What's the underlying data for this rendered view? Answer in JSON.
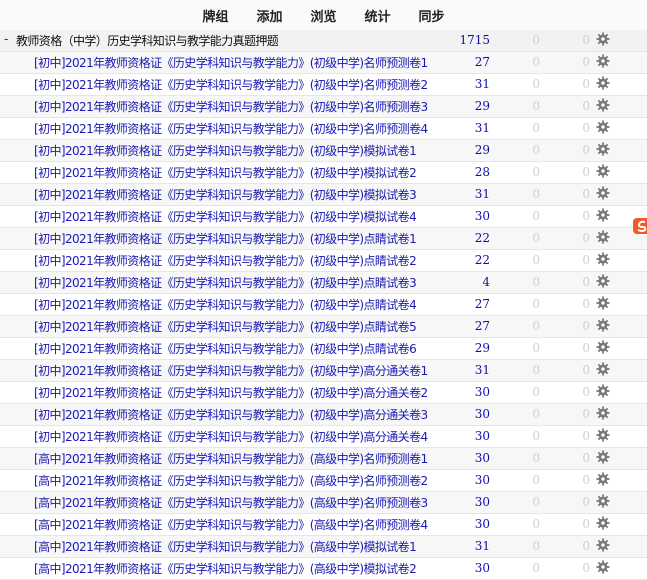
{
  "toolbar": {
    "items": [
      "牌组",
      "添加",
      "浏览",
      "统计",
      "同步"
    ]
  },
  "parent": {
    "toggle": "-",
    "name": "教师资格（中学）历史学科知识与教学能力真题押题",
    "new": "1715",
    "learn": "0",
    "due": "0"
  },
  "decks": [
    {
      "name": "[初中]2021年教师资格证《历史学科知识与教学能力》(初级中学)名师预测卷1",
      "new": "27",
      "learn": "0",
      "due": "0"
    },
    {
      "name": "[初中]2021年教师资格证《历史学科知识与教学能力》(初级中学)名师预测卷2",
      "new": "31",
      "learn": "0",
      "due": "0"
    },
    {
      "name": "[初中]2021年教师资格证《历史学科知识与教学能力》(初级中学)名师预测卷3",
      "new": "29",
      "learn": "0",
      "due": "0"
    },
    {
      "name": "[初中]2021年教师资格证《历史学科知识与教学能力》(初级中学)名师预测卷4",
      "new": "31",
      "learn": "0",
      "due": "0"
    },
    {
      "name": "[初中]2021年教师资格证《历史学科知识与教学能力》(初级中学)模拟试卷1",
      "new": "29",
      "learn": "0",
      "due": "0"
    },
    {
      "name": "[初中]2021年教师资格证《历史学科知识与教学能力》(初级中学)模拟试卷2",
      "new": "28",
      "learn": "0",
      "due": "0"
    },
    {
      "name": "[初中]2021年教师资格证《历史学科知识与教学能力》(初级中学)模拟试卷3",
      "new": "31",
      "learn": "0",
      "due": "0"
    },
    {
      "name": "[初中]2021年教师资格证《历史学科知识与教学能力》(初级中学)模拟试卷4",
      "new": "30",
      "learn": "0",
      "due": "0"
    },
    {
      "name": "[初中]2021年教师资格证《历史学科知识与教学能力》(初级中学)点睛试卷1",
      "new": "22",
      "learn": "0",
      "due": "0"
    },
    {
      "name": "[初中]2021年教师资格证《历史学科知识与教学能力》(初级中学)点睛试卷2",
      "new": "22",
      "learn": "0",
      "due": "0"
    },
    {
      "name": "[初中]2021年教师资格证《历史学科知识与教学能力》(初级中学)点睛试卷3",
      "new": "4",
      "learn": "0",
      "due": "0"
    },
    {
      "name": "[初中]2021年教师资格证《历史学科知识与教学能力》(初级中学)点睛试卷4",
      "new": "27",
      "learn": "0",
      "due": "0"
    },
    {
      "name": "[初中]2021年教师资格证《历史学科知识与教学能力》(初级中学)点睛试卷5",
      "new": "27",
      "learn": "0",
      "due": "0"
    },
    {
      "name": "[初中]2021年教师资格证《历史学科知识与教学能力》(初级中学)点睛试卷6",
      "new": "29",
      "learn": "0",
      "due": "0"
    },
    {
      "name": "[初中]2021年教师资格证《历史学科知识与教学能力》(初级中学)高分通关卷1",
      "new": "31",
      "learn": "0",
      "due": "0"
    },
    {
      "name": "[初中]2021年教师资格证《历史学科知识与教学能力》(初级中学)高分通关卷2",
      "new": "30",
      "learn": "0",
      "due": "0"
    },
    {
      "name": "[初中]2021年教师资格证《历史学科知识与教学能力》(初级中学)高分通关卷3",
      "new": "30",
      "learn": "0",
      "due": "0"
    },
    {
      "name": "[初中]2021年教师资格证《历史学科知识与教学能力》(初级中学)高分通关卷4",
      "new": "30",
      "learn": "0",
      "due": "0"
    },
    {
      "name": "[高中]2021年教师资格证《历史学科知识与教学能力》(高级中学)名师预测卷1",
      "new": "30",
      "learn": "0",
      "due": "0"
    },
    {
      "name": "[高中]2021年教师资格证《历史学科知识与教学能力》(高级中学)名师预测卷2",
      "new": "30",
      "learn": "0",
      "due": "0"
    },
    {
      "name": "[高中]2021年教师资格证《历史学科知识与教学能力》(高级中学)名师预测卷3",
      "new": "30",
      "learn": "0",
      "due": "0"
    },
    {
      "name": "[高中]2021年教师资格证《历史学科知识与教学能力》(高级中学)名师预测卷4",
      "new": "30",
      "learn": "0",
      "due": "0"
    },
    {
      "name": "[高中]2021年教师资格证《历史学科知识与教学能力》(高级中学)模拟试卷1",
      "new": "31",
      "learn": "0",
      "due": "0"
    },
    {
      "name": "[高中]2021年教师资格证《历史学科知识与教学能力》(高级中学)模拟试卷2",
      "new": "30",
      "learn": "0",
      "due": "0"
    }
  ],
  "colors": {
    "deck_link": "#1a1ab3",
    "new_count": "#1010a0",
    "zero_count": "#cfcfcf",
    "gear": "#777777",
    "side_badge": "#f05a28"
  },
  "icons": {
    "gear": "gear-icon",
    "side_badge": "input-method-icon"
  }
}
